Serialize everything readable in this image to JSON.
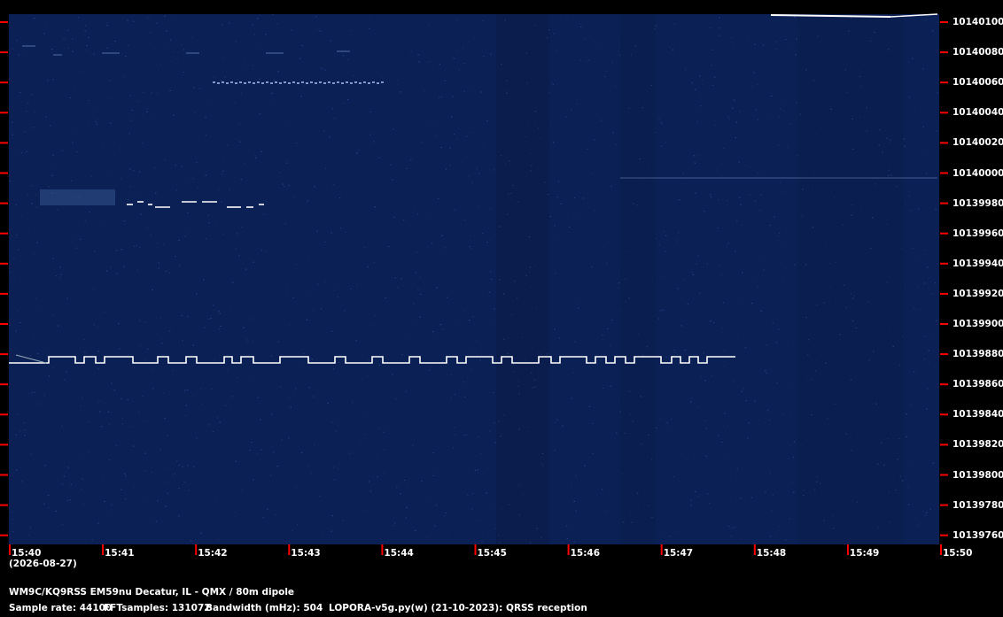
{
  "window": {
    "title": "WM9C/KQ9RSS EM59nu Decatur, IL - QMX / 80m dipole"
  },
  "spectrogram": {
    "background_color": "#0b2054",
    "signal_color": "#ffffff",
    "tick_color": "#ff0000",
    "frequency_labels": [
      "10140100",
      "10140080",
      "10140060",
      "10140040",
      "10140020",
      "10140000",
      "10139980",
      "10139960",
      "10139940",
      "10139920",
      "10139900",
      "10139880",
      "10139860",
      "10139840",
      "10139820",
      "10139800",
      "10139780",
      "10139760"
    ],
    "time_labels": [
      "15:40",
      "15:41",
      "15:42",
      "15:43",
      "15:44",
      "15:45",
      "15:46",
      "15:47",
      "15:48",
      "15:49",
      "15:50"
    ],
    "date": "(2026-08-27)"
  },
  "footer": {
    "station_line": "WM9C/KQ9RSS EM59nu Decatur, IL - QMX / 80m dipole",
    "sample_rate": "Sample rate: 44100",
    "fft_samples": "FFTsamples: 131072",
    "bandwidth": "Bandwidth (mHz): 504",
    "software": "LOPORA-v5g.py(w) (21-10-2023): QRSS reception"
  }
}
